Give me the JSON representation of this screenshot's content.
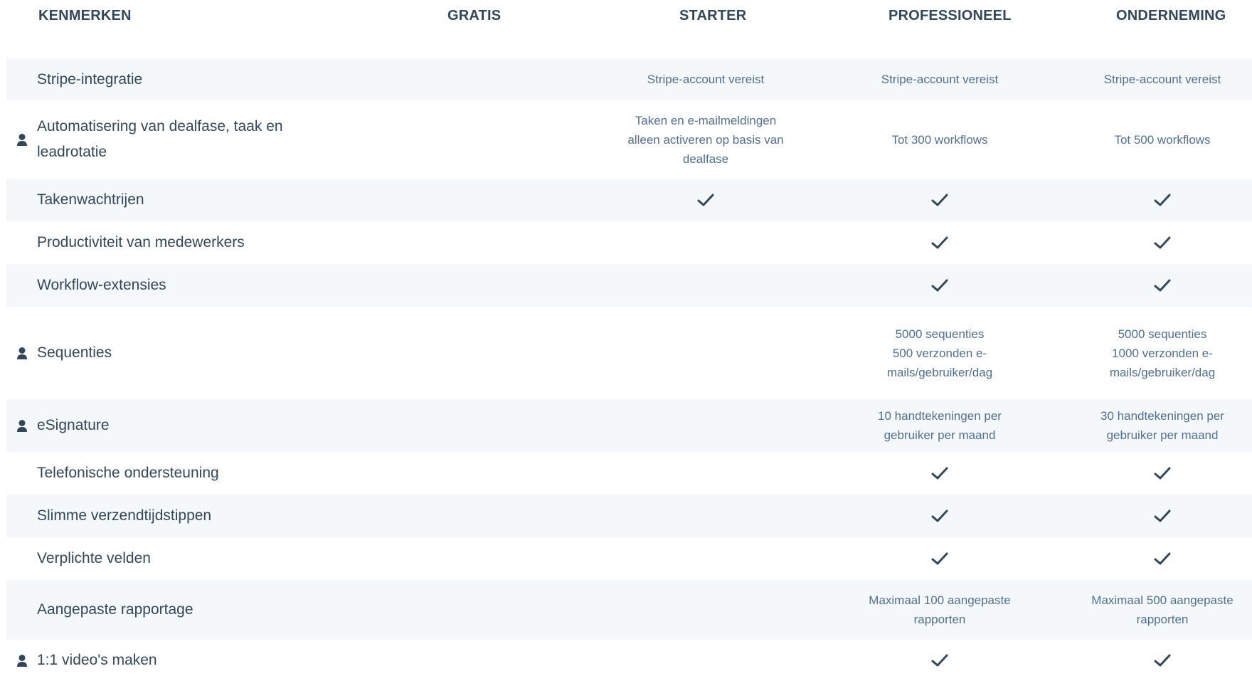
{
  "header": {
    "features": "KENMERKEN",
    "free": "GRATIS",
    "starter": "STARTER",
    "professional": "PROFESSIONEEL",
    "enterprise": "ONDERNEMING"
  },
  "rows": [
    {
      "feature": "Stripe-integratie",
      "icon": false,
      "starter": "Stripe-account vereist",
      "pro": "Stripe-account vereist",
      "ent": "Stripe-account vereist"
    },
    {
      "feature": "Automatisering van dealfase, taak en leadrotatie",
      "icon": "person-icon",
      "starter": "Taken en e-mailmeldingen\nalleen activeren op basis van\ndealfase",
      "pro": "Tot 300 workflows",
      "ent": "Tot 500 workflows"
    },
    {
      "feature": "Takenwachtrijen",
      "icon": false,
      "starter": "check",
      "pro": "check",
      "ent": "check"
    },
    {
      "feature": "Productiviteit van medewerkers",
      "icon": false,
      "starter": "",
      "pro": "check",
      "ent": "check"
    },
    {
      "feature": "Workflow-extensies",
      "icon": false,
      "starter": "",
      "pro": "check",
      "ent": "check"
    },
    {
      "feature": "Sequenties",
      "icon": "person-icon",
      "starter": "",
      "pro": "5000 sequenties\n500 verzonden e-\nmails/gebruiker/dag",
      "ent": "5000 sequenties\n1000 verzonden e-\nmails/gebruiker/dag"
    },
    {
      "feature": "eSignature",
      "icon": "person-icon",
      "starter": "",
      "pro": "10 handtekeningen per\ngebruiker per maand",
      "ent": "30 handtekeningen per\ngebruiker per maand"
    },
    {
      "feature": "Telefonische ondersteuning",
      "icon": false,
      "starter": "",
      "pro": "check",
      "ent": "check"
    },
    {
      "feature": "Slimme verzendtijdstippen",
      "icon": false,
      "starter": "",
      "pro": "check",
      "ent": "check"
    },
    {
      "feature": "Verplichte velden",
      "icon": false,
      "starter": "",
      "pro": "check",
      "ent": "check"
    },
    {
      "feature": "Aangepaste rapportage",
      "icon": false,
      "starter": "",
      "pro": "Maximaal 100 aangepaste\nrapporten",
      "ent": "Maximaal 500 aangepaste\nrapporten"
    },
    {
      "feature": "1:1 video's maken",
      "icon": "person-icon",
      "starter": "",
      "pro": "check",
      "ent": "check"
    }
  ],
  "colors": {
    "text": "#33475b",
    "subtext": "#516f90",
    "shade": "#f5f8fa"
  }
}
